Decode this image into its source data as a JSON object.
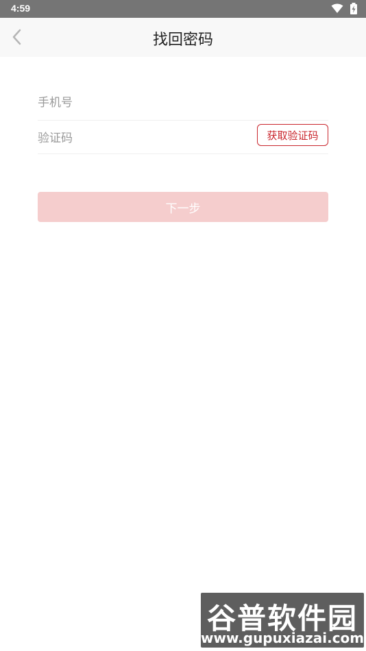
{
  "status_bar": {
    "time": "4:59",
    "icons": [
      "wifi-icon",
      "battery-icon"
    ]
  },
  "header": {
    "back_icon": "chevron-left-icon",
    "title": "找回密码"
  },
  "form": {
    "phone_placeholder": "手机号",
    "code_placeholder": "验证码",
    "get_code_label": "获取验证码",
    "next_label": "下一步"
  },
  "watermark": {
    "title": "谷普软件园",
    "url": "www.gupuxiazai.com"
  },
  "colors": {
    "status_bar": "#757575",
    "nav_bar": "#f8f8f8",
    "accent": "#c9252c",
    "button_disabled": "#f5cdcd"
  }
}
